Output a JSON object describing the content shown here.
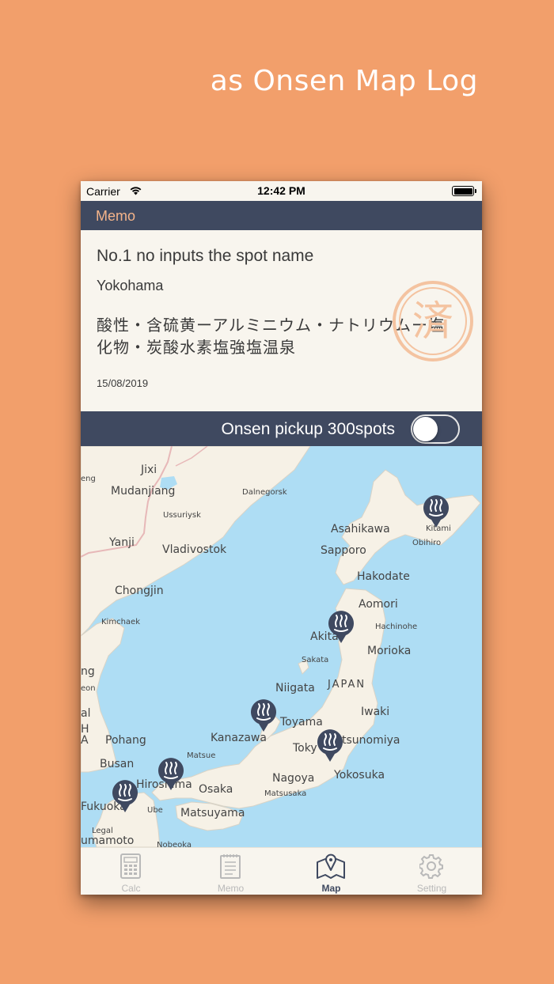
{
  "promo": {
    "title": "as Onsen Map Log"
  },
  "status_bar": {
    "carrier": "Carrier",
    "time": "12:42 PM"
  },
  "nav": {
    "title": "Memo"
  },
  "memo": {
    "spot_name": "No.1 no inputs the spot name",
    "location": "Yokohama",
    "spring_type": "酸性・含硫黄ーアルミニウム・ナトリウムー塩化物・炭酸水素塩強塩温泉",
    "date": "15/08/2019",
    "stamp_text": "済"
  },
  "toggle": {
    "label": "Onsen pickup 300spots",
    "state": "off"
  },
  "map": {
    "labels": {
      "jixi": "Jixi",
      "mudanjiang": "Mudanjiang",
      "dalnegorsk": "Dalnegorsk",
      "ussuriysk": "Ussuriysk",
      "yanji": "Yanji",
      "vladivostok": "Vladivostok",
      "asahikawa": "Asahikawa",
      "kitami": "Kitami",
      "sapporo": "Sapporo",
      "obihiro": "Obihiro",
      "hakodate": "Hakodate",
      "chongjin": "Chongjin",
      "aomori": "Aomori",
      "kimchaek": "Kimchaek",
      "akita": "Akita",
      "hachinohe": "Hachinohe",
      "sakata": "Sakata",
      "morioka": "Morioka",
      "niigata": "Niigata",
      "japan": "JAPAN",
      "iwaki": "Iwaki",
      "toyama": "Toyama",
      "kanazawa": "Kanazawa",
      "pohang": "Pohang",
      "tokyo": "Toky",
      "utsunomiya": "tsunomiya",
      "busan": "Busan",
      "matsue": "Matsue",
      "hiroshima": "Hiroshima",
      "osaka": "Osaka",
      "nagoya": "Nagoya",
      "yokosuka": "Yokosuka",
      "fukuoka": "Fukuoka",
      "ube": "Ube",
      "matsusaka": "Matsusaka",
      "matsuyama": "Matsuyama",
      "kumamoto": "umamoto",
      "nobeoka": "Nobeoka",
      "legal": "Legal",
      "feng": "eng",
      "eon": "eon",
      "ng": "ng",
      "al": "al",
      "h": "H",
      "a": "A"
    },
    "pin_icon": "onsen-icon"
  },
  "tabs": [
    {
      "label": "Calc",
      "icon": "calculator-icon",
      "active": false
    },
    {
      "label": "Memo",
      "icon": "notepad-icon",
      "active": false
    },
    {
      "label": "Map",
      "icon": "map-pin-icon",
      "active": true
    },
    {
      "label": "Setting",
      "icon": "gear-icon",
      "active": false
    }
  ],
  "colors": {
    "background": "#F29F6B",
    "navy": "#3F4960",
    "accent": "#F4B48A",
    "sea": "#AEDDF4",
    "land": "#F6F1E6"
  }
}
